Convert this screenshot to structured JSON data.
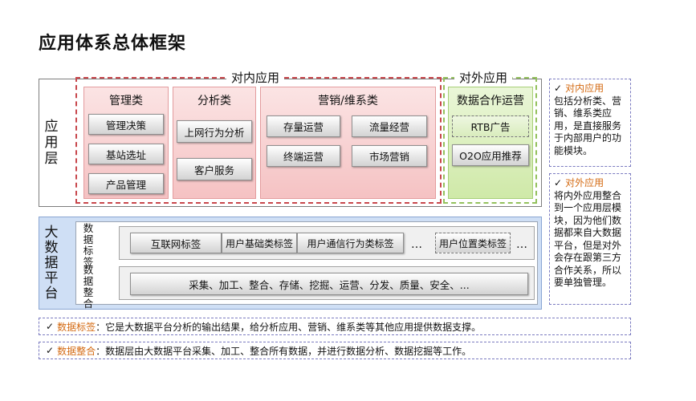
{
  "title": "应用体系总体框架",
  "app_layer": {
    "label_chars": [
      "应",
      "用",
      "层"
    ],
    "inner": {
      "title": "对内应用",
      "groups": {
        "management": {
          "title": "管理类",
          "items": [
            "管理决策",
            "基站选址",
            "产品管理"
          ]
        },
        "analysis": {
          "title": "分析类",
          "items": [
            "上网行为分析",
            "客户服务"
          ]
        },
        "marketing": {
          "title": "营销/维系类",
          "items": [
            "存量运营",
            "流量经营",
            "终端运营",
            "市场营销"
          ]
        }
      }
    },
    "outer": {
      "title": "对外应用",
      "group_title": "数据合作运营",
      "items": [
        "RTB广告",
        "O2O应用推荐"
      ]
    }
  },
  "data_layer": {
    "label_chars": [
      "大",
      "数",
      "据",
      "平",
      "台"
    ],
    "tags_label_chars": [
      "数",
      "据",
      "标",
      "签"
    ],
    "integration_label_chars": [
      "数",
      "据",
      "整",
      "合"
    ],
    "tags": [
      "互联网标签",
      "用户基础类标签",
      "用户通信行为类标签",
      "用户位置类标签"
    ],
    "ellipsis": "…",
    "process_text": "采集、加工、整合、存储、挖掘、运营、分发、质量、安全、..."
  },
  "notes": {
    "check": "✓",
    "inner": {
      "head": "对内应用",
      "body": "包括分析类、营销、维系类应用，是直接服务于内部用户的功能模块。"
    },
    "outer": {
      "head": "对外应用",
      "body": "将内外应用整合到一个应用层模块，因为他们数据都来自大数据平台，但是对外会存在跟第三方合作关系，所以要单独管理。"
    }
  },
  "footnotes": [
    {
      "key": "数据标签",
      "text": "：它是大数据平台分析的输出结果，给分析应用、营销、维系类等其他应用提供数据支撑。"
    },
    {
      "key": "数据整合",
      "text": "：数据层由大数据平台采集、加工、整合所有数据，并进行数据分析、数据挖掘等工作。"
    }
  ],
  "colors": {
    "inner_region_border": "#c8474c",
    "outer_region_border": "#93c15c",
    "data_layer_bg": "#cfdff5",
    "note_highlight": "#d46a12"
  }
}
